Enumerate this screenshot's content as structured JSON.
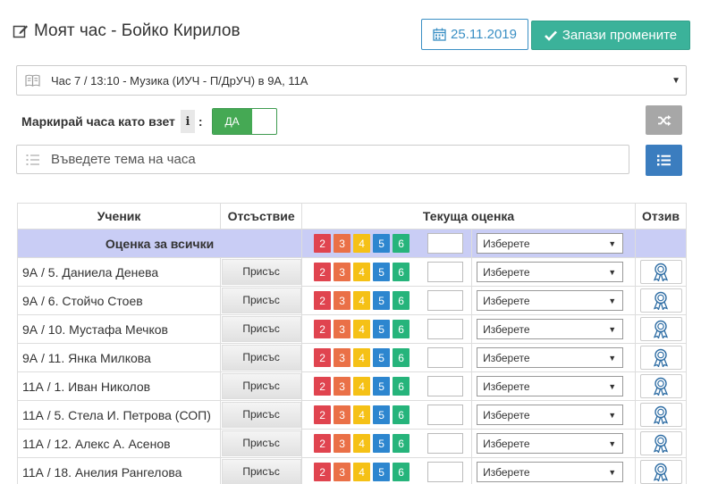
{
  "header": {
    "title": "Моят час - Бойко Кирилов",
    "date": "25.11.2019",
    "save_label": "Запази промените"
  },
  "lesson": {
    "selected": "Час 7 / 13:10 - Музика (ИУЧ - П/ДрУЧ) в 9А, 11А"
  },
  "mark_taken": {
    "label": "Маркирай часа като взет",
    "colon": ":",
    "info": "i",
    "toggle_value": "ДА"
  },
  "topic": {
    "placeholder": "Въведете тема на часа"
  },
  "table": {
    "headers": {
      "student": "Ученик",
      "absence": "Отсъствие",
      "grade": "Текуща оценка",
      "review": "Отзив"
    },
    "all_row_label": "Оценка за всички",
    "grade_values": [
      "2",
      "3",
      "4",
      "5",
      "6"
    ],
    "select_placeholder": "Изберете",
    "present_label": "Присъс",
    "students": [
      {
        "name": "9А / 5. Даниела Денева"
      },
      {
        "name": "9А / 6. Стойчо Стоев"
      },
      {
        "name": "9А / 10. Мустафа Мечков"
      },
      {
        "name": "9А / 11. Янка Милкова"
      },
      {
        "name": "11А / 1. Иван Николов"
      },
      {
        "name": "11А / 5. Стела И. Петрова (СОП)"
      },
      {
        "name": "11А / 12. Алекс А. Асенов"
      },
      {
        "name": "11А / 18. Анелия Рангелова"
      }
    ]
  },
  "colors": {
    "save_button": "#3bb29a",
    "date_border": "#3a8fc4",
    "toggle_on": "#45a954",
    "all_row_bg": "#c9cdf5",
    "grade_2": "#e0444f",
    "grade_3": "#ea7047",
    "grade_4": "#f5c116",
    "grade_5": "#2d86cf",
    "grade_6": "#26b47b"
  }
}
